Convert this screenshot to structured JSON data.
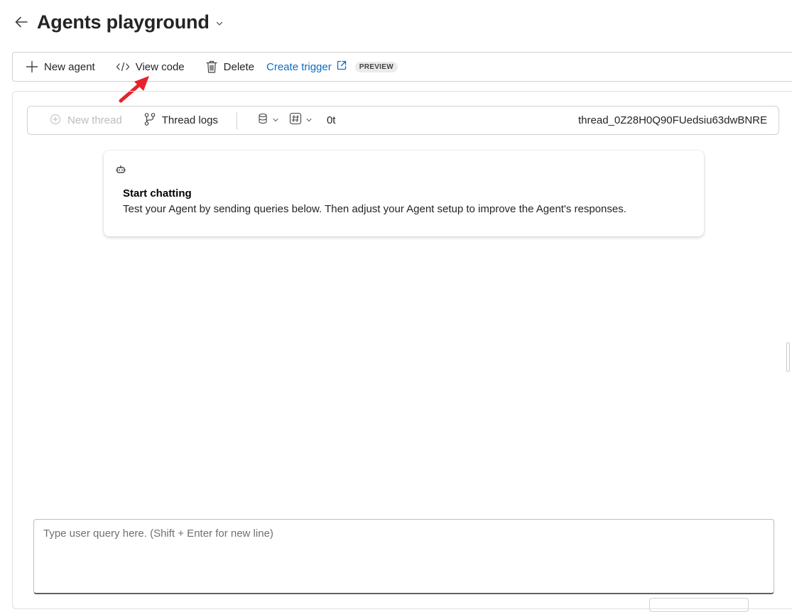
{
  "header": {
    "title": "Agents playground"
  },
  "toolbar": {
    "new_agent": "New agent",
    "view_code": "View code",
    "delete": "Delete",
    "create_trigger": "Create trigger",
    "preview_badge": "PREVIEW"
  },
  "thread_bar": {
    "new_thread": "New thread",
    "thread_logs": "Thread logs",
    "token_count": "0t",
    "thread_id": "thread_0Z28H0Q90FUedsiu63dwBNRE"
  },
  "start_card": {
    "title": "Start chatting",
    "description": "Test your Agent by sending queries below. Then adjust your Agent setup to improve the Agent's responses."
  },
  "query": {
    "placeholder": "Type user query here. (Shift + Enter for new line)",
    "value": ""
  },
  "colors": {
    "accent": "#0f6cbd",
    "annotation_arrow": "#e8222a",
    "disabled_text": "#bdbdbd"
  },
  "icons": [
    "back-arrow-icon",
    "chevron-down-icon",
    "plus-icon",
    "code-icon",
    "trash-icon",
    "external-link-icon",
    "add-chat-icon",
    "branch-icon",
    "database-icon",
    "hash-icon",
    "bot-icon"
  ]
}
